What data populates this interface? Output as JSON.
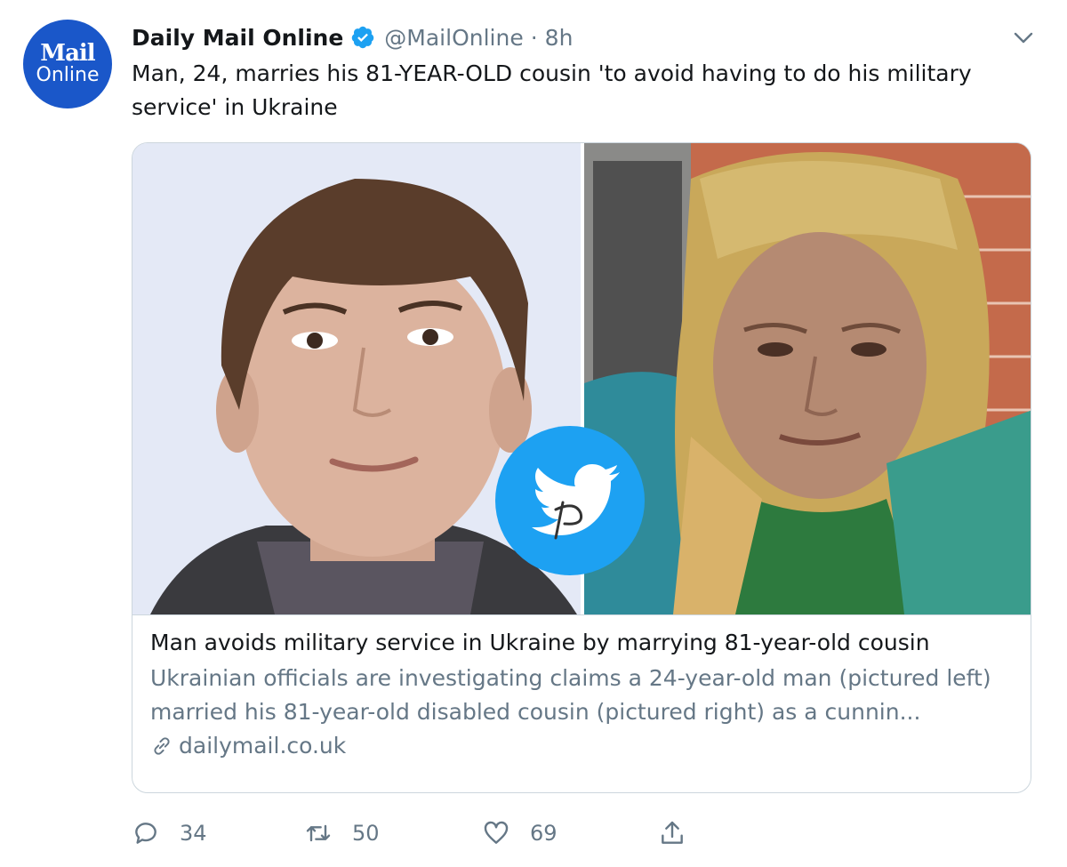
{
  "author": {
    "avatar_line1": "Mail",
    "avatar_line2": "Online",
    "name": "Daily Mail Online",
    "handle": "@MailOnline",
    "separator": "·",
    "time": "8h"
  },
  "tweet": {
    "text": "Man, 24, marries his 81-YEAR-OLD cousin 'to avoid having to do his military service' in Ukraine"
  },
  "card": {
    "title": "Man avoids military service in Ukraine by marrying 81-year-old cousin",
    "description": "Ukrainian officials are investigating claims a 24-year-old man (pictured left) married his 81-year-old disabled cousin (pictured right) as a cunnin...",
    "domain": "dailymail.co.uk"
  },
  "actions": {
    "replies": "34",
    "retweets": "50",
    "likes": "69"
  },
  "colors": {
    "text": "#14171a",
    "secondary": "#657786",
    "accent": "#1da1f2",
    "avatar_bg": "#1a57c9"
  },
  "icons": {
    "verified": "verified-badge-icon",
    "caret": "chevron-down-icon",
    "link": "link-icon",
    "reply": "reply-icon",
    "retweet": "retweet-icon",
    "like": "heart-icon",
    "share": "share-icon",
    "watermark": "twitter-bird-watermark"
  }
}
